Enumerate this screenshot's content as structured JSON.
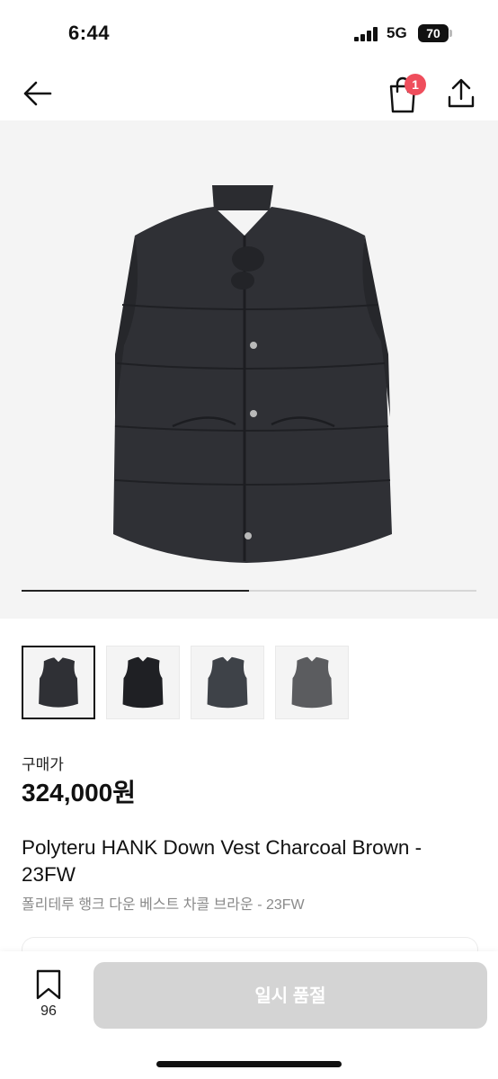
{
  "status_bar": {
    "time": "6:44",
    "network": "5G",
    "battery": "70"
  },
  "nav": {
    "back_icon": "arrow-left-icon",
    "bag_icon": "shopping-bag-icon",
    "cart_count": "1",
    "share_icon": "share-icon"
  },
  "gallery": {
    "progress": 0.5,
    "thumbnail_count": 4,
    "selected_index": 0
  },
  "price": {
    "label": "구매가",
    "value": "324,000원"
  },
  "product": {
    "title": "Polyteru HANK Down Vest Charcoal Brown - 23FW",
    "subtitle": "폴리테루 행크 다운 베스트 차콜 브라운 - 23FW"
  },
  "bottom_bar": {
    "wish_icon": "bookmark-icon",
    "wish_count": "96",
    "buy_label": "일시 품절"
  },
  "colors": {
    "badge": "#ef4e5c",
    "disabled_button": "#d4d4d4",
    "gallery_bg": "#f4f4f4"
  }
}
